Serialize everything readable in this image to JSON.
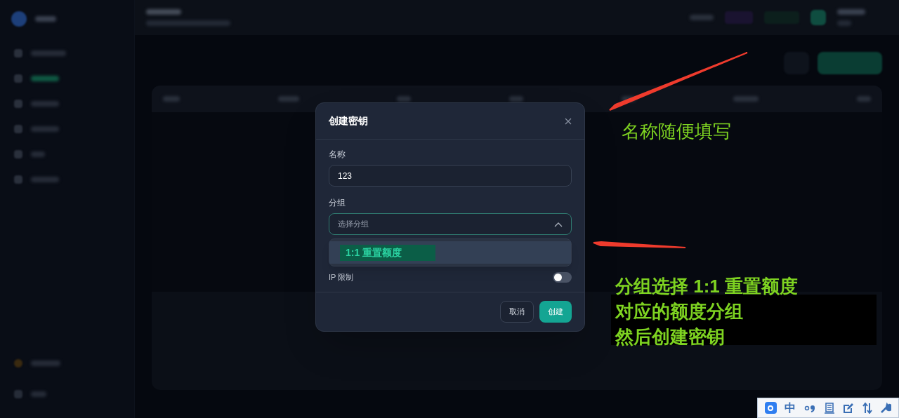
{
  "dialog": {
    "title": "创建密钥",
    "fields": [
      {
        "label": "名称",
        "kind": "input",
        "value": "123"
      },
      {
        "label": "分组",
        "kind": "select",
        "placeholder": "选择分组",
        "expanded": true,
        "options": [
          {
            "label": "1:1 重置额度",
            "highlighted": true
          }
        ]
      }
    ],
    "toggles": [
      {
        "label": "IP 限制",
        "on": false
      }
    ],
    "buttons": [
      {
        "label": "取消",
        "kind": "secondary"
      },
      {
        "label": "创建",
        "kind": "primary"
      }
    ]
  },
  "annotations": [
    {
      "lines": [
        "名称随便填写"
      ],
      "bold": false
    },
    {
      "lines": [
        "分组选择 1:1 重置额度",
        "对应的额度分组",
        "然后创建密钥"
      ],
      "bold": true
    }
  ],
  "ime_toolbar": {
    "mode": "中"
  }
}
